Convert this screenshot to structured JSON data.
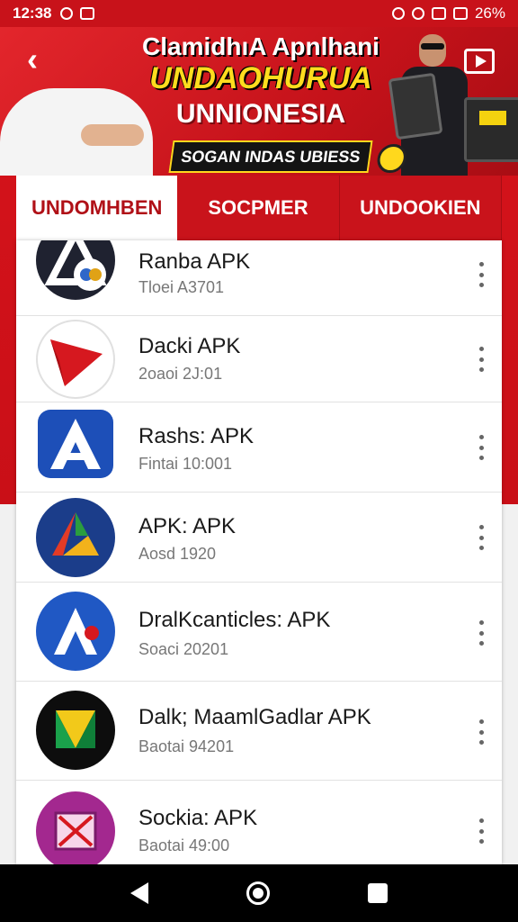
{
  "status_bar": {
    "time": "12:38",
    "battery": "26%"
  },
  "banner": {
    "line1": "ClamidhıA Apnlhani",
    "line2": "UNDAOHURUA",
    "line3": "UNNIONESIA",
    "tagline": "SOGAN INDAS UBIESS"
  },
  "tabs": [
    {
      "label": "UNDOMHBEN",
      "active": true
    },
    {
      "label": "SOCPMER",
      "active": false
    },
    {
      "label": "UNDOOKIEN",
      "active": false
    }
  ],
  "apps": [
    {
      "name": "Ranba APK",
      "meta": "Tloei A3701",
      "icon": "triangle-logo-icon"
    },
    {
      "name": "Dacki APK",
      "meta": "2oaoi 2J:01",
      "icon": "red-arrow-icon"
    },
    {
      "name": "Rashs: APK",
      "meta": "Fintai 10:001",
      "icon": "blue-a-icon"
    },
    {
      "name": "APK: APK",
      "meta": "Aosd 1920",
      "icon": "drive-triangle-icon"
    },
    {
      "name": "DralKcanticles: APK",
      "meta": "Soaci 20201",
      "icon": "blue-a-circle-icon"
    },
    {
      "name": "Dalk; MaamlGadlar APK",
      "meta": "Baotai 94201",
      "icon": "green-yellow-icon"
    },
    {
      "name": "Sockia: APK",
      "meta": "Baotai 49:00",
      "icon": "purple-square-icon"
    }
  ],
  "colors": {
    "accent": "#c9131b",
    "highlight": "#ffdc1e"
  }
}
